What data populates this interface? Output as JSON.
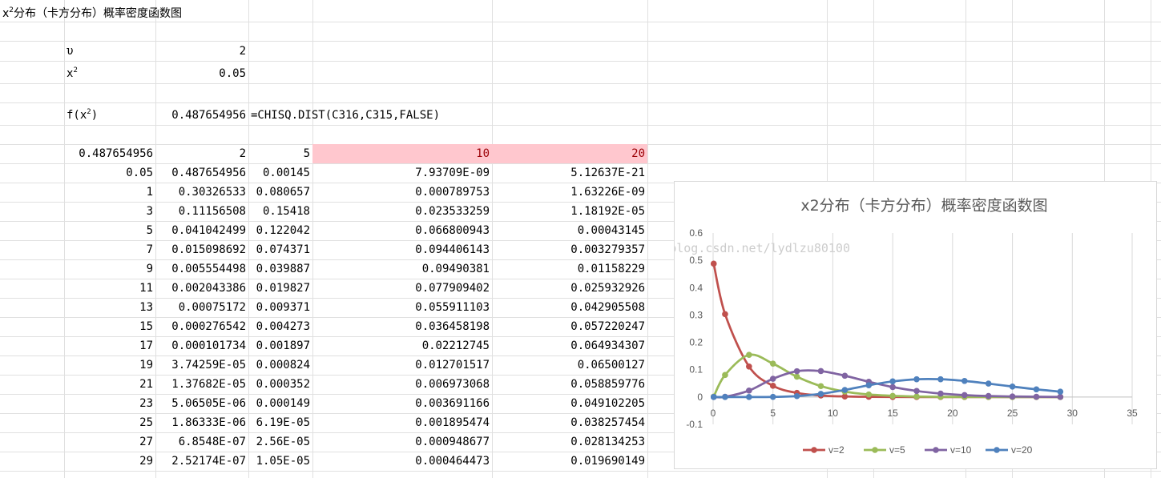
{
  "sheet": {
    "title_prefix": "x",
    "title_sup": "2",
    "title_rest": "分布（卡方分布）概率密度函数图",
    "params": {
      "nu_label": "υ",
      "nu_value": "2",
      "x2_label": "x",
      "x2_label_sup": "2",
      "x2_value": "0.05",
      "f_label_pre": "f(x",
      "f_label_sup": "2",
      "f_label_post": ")",
      "f_value": "0.487654956",
      "formula": "=CHISQ.DIST(C316,C315,FALSE)"
    },
    "header_row": [
      "0.487654956",
      "2",
      "5",
      "10",
      "20"
    ],
    "rows": [
      [
        "0.05",
        "0.487654956",
        "0.00145",
        "7.93709E-09",
        "5.12637E-21"
      ],
      [
        "1",
        "0.30326533",
        "0.080657",
        "0.000789753",
        "1.63226E-09"
      ],
      [
        "3",
        "0.11156508",
        "0.15418",
        "0.023533259",
        "1.18192E-05"
      ],
      [
        "5",
        "0.041042499",
        "0.122042",
        "0.066800943",
        "0.00043145"
      ],
      [
        "7",
        "0.015098692",
        "0.074371",
        "0.094406143",
        "0.003279357"
      ],
      [
        "9",
        "0.005554498",
        "0.039887",
        "0.09490381",
        "0.01158229"
      ],
      [
        "11",
        "0.002043386",
        "0.019827",
        "0.077909402",
        "0.025932926"
      ],
      [
        "13",
        "0.00075172",
        "0.009371",
        "0.055911103",
        "0.042905508"
      ],
      [
        "15",
        "0.000276542",
        "0.004273",
        "0.036458198",
        "0.057220247"
      ],
      [
        "17",
        "0.000101734",
        "0.001897",
        "0.02212745",
        "0.064934307"
      ],
      [
        "19",
        "3.74259E-05",
        "0.000824",
        "0.012701517",
        "0.06500127"
      ],
      [
        "21",
        "1.37682E-05",
        "0.000352",
        "0.006973068",
        "0.058859776"
      ],
      [
        "23",
        "5.06505E-06",
        "0.000149",
        "0.003691166",
        "0.049102205"
      ],
      [
        "25",
        "1.86333E-06",
        "6.19E-05",
        "0.001895474",
        "0.038257454"
      ],
      [
        "27",
        "6.8548E-07",
        "2.56E-05",
        "0.000948677",
        "0.028134253"
      ],
      [
        "29",
        "2.52174E-07",
        "1.05E-05",
        "0.000464473",
        "0.019690149"
      ]
    ]
  },
  "watermark": "http://blog.csdn.net/lydlzu80100",
  "chart_data": {
    "type": "line",
    "title": "x2分布（卡方分布）概率密度函数图",
    "xlim": [
      0,
      35
    ],
    "ylim": [
      -0.1,
      0.6
    ],
    "xticks": [
      0,
      5,
      10,
      15,
      20,
      25,
      30,
      35
    ],
    "yticks": [
      -0.1,
      0,
      0.1,
      0.2,
      0.3,
      0.4,
      0.5,
      0.6
    ],
    "grid": "vertical",
    "legend_position": "bottom",
    "x": [
      0.05,
      1,
      3,
      5,
      7,
      9,
      11,
      13,
      15,
      17,
      19,
      21,
      23,
      25,
      27,
      29
    ],
    "series": [
      {
        "name": "v=2",
        "color": "#c0504d",
        "values": [
          0.487654956,
          0.30326533,
          0.11156508,
          0.041042499,
          0.015098692,
          0.005554498,
          0.002043386,
          0.00075172,
          0.000276542,
          0.000101734,
          3.74259e-05,
          1.37682e-05,
          5.06505e-06,
          1.86333e-06,
          6.8548e-07,
          2.52174e-07
        ]
      },
      {
        "name": "v=5",
        "color": "#9bbb59",
        "values": [
          0.00145,
          0.080657,
          0.15418,
          0.122042,
          0.074371,
          0.039887,
          0.019827,
          0.009371,
          0.004273,
          0.001897,
          0.000824,
          0.000352,
          0.000149,
          6.19e-05,
          2.56e-05,
          1.05e-05
        ]
      },
      {
        "name": "v=10",
        "color": "#8064a2",
        "values": [
          7.93709e-09,
          0.000789753,
          0.023533259,
          0.066800943,
          0.094406143,
          0.09490381,
          0.077909402,
          0.055911103,
          0.036458198,
          0.02212745,
          0.012701517,
          0.006973068,
          0.003691166,
          0.001895474,
          0.000948677,
          0.000464473
        ]
      },
      {
        "name": "v=20",
        "color": "#4f81bd",
        "values": [
          5.12637e-21,
          1.63226e-09,
          1.18192e-05,
          0.00043145,
          0.003279357,
          0.01158229,
          0.025932926,
          0.042905508,
          0.057220247,
          0.064934307,
          0.06500127,
          0.058859776,
          0.049102205,
          0.038257454,
          0.028134253,
          0.019690149
        ]
      }
    ]
  }
}
